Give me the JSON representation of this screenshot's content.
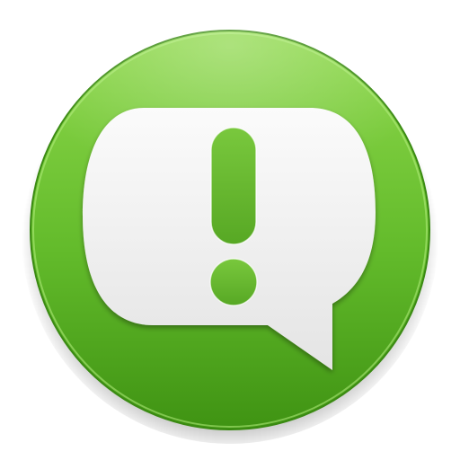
{
  "icon": {
    "name": "speech-bubble-alert-icon",
    "depicts": "exclamation-mark-icon",
    "colors": {
      "disc_top": "#8fd94c",
      "disc_mid": "#63bb2b",
      "disc_bottom": "#3f9313",
      "disc_rim": "#3a8a12",
      "bubble_top": "#fbfbfb",
      "bubble_bottom": "#e4e4e4",
      "mark_top": "#79c83d",
      "mark_bottom": "#57a824"
    }
  }
}
